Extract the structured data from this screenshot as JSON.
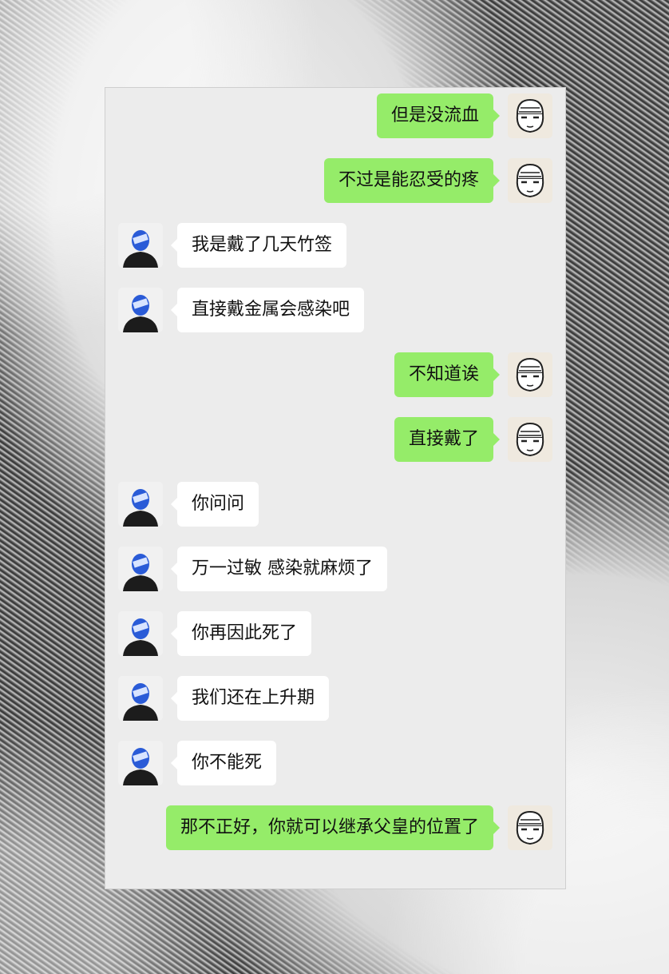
{
  "colors": {
    "outgoing_bubble": "#95ec69",
    "incoming_bubble": "#ffffff",
    "chat_background": "#ececec"
  },
  "avatars": {
    "me": "cartoon-face-with-cap-avatar",
    "them": "blue-head-figure-avatar"
  },
  "messages": [
    {
      "sender": "me",
      "text": "但是没流血"
    },
    {
      "sender": "me",
      "text": "不过是能忍受的疼"
    },
    {
      "sender": "them",
      "text": "我是戴了几天竹签"
    },
    {
      "sender": "them",
      "text": "直接戴金属会感染吧"
    },
    {
      "sender": "me",
      "text": "不知道诶"
    },
    {
      "sender": "me",
      "text": "直接戴了"
    },
    {
      "sender": "them",
      "text": "你问问"
    },
    {
      "sender": "them",
      "text": "万一过敏 感染就麻烦了"
    },
    {
      "sender": "them",
      "text": "你再因此死了"
    },
    {
      "sender": "them",
      "text": "我们还在上升期"
    },
    {
      "sender": "them",
      "text": "你不能死"
    },
    {
      "sender": "me",
      "text": "那不正好，你就可以继承父皇的位置了"
    }
  ]
}
